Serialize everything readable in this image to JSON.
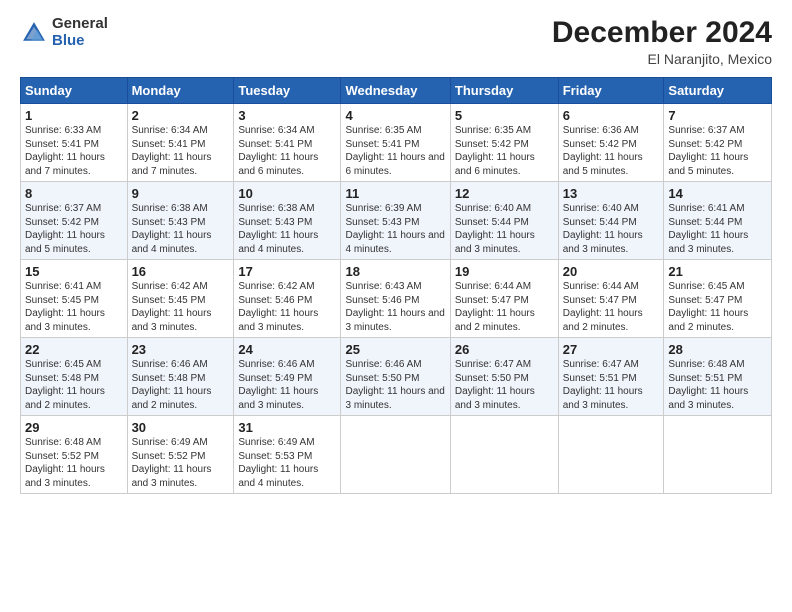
{
  "header": {
    "logo_general": "General",
    "logo_blue": "Blue",
    "month_year": "December 2024",
    "location": "El Naranjito, Mexico"
  },
  "days_of_week": [
    "Sunday",
    "Monday",
    "Tuesday",
    "Wednesday",
    "Thursday",
    "Friday",
    "Saturday"
  ],
  "weeks": [
    [
      {
        "day": "1",
        "sunrise": "6:33 AM",
        "sunset": "5:41 PM",
        "daylight": "11 hours and 7 minutes."
      },
      {
        "day": "2",
        "sunrise": "6:34 AM",
        "sunset": "5:41 PM",
        "daylight": "11 hours and 7 minutes."
      },
      {
        "day": "3",
        "sunrise": "6:34 AM",
        "sunset": "5:41 PM",
        "daylight": "11 hours and 6 minutes."
      },
      {
        "day": "4",
        "sunrise": "6:35 AM",
        "sunset": "5:41 PM",
        "daylight": "11 hours and 6 minutes."
      },
      {
        "day": "5",
        "sunrise": "6:35 AM",
        "sunset": "5:42 PM",
        "daylight": "11 hours and 6 minutes."
      },
      {
        "day": "6",
        "sunrise": "6:36 AM",
        "sunset": "5:42 PM",
        "daylight": "11 hours and 5 minutes."
      },
      {
        "day": "7",
        "sunrise": "6:37 AM",
        "sunset": "5:42 PM",
        "daylight": "11 hours and 5 minutes."
      }
    ],
    [
      {
        "day": "8",
        "sunrise": "6:37 AM",
        "sunset": "5:42 PM",
        "daylight": "11 hours and 5 minutes."
      },
      {
        "day": "9",
        "sunrise": "6:38 AM",
        "sunset": "5:43 PM",
        "daylight": "11 hours and 4 minutes."
      },
      {
        "day": "10",
        "sunrise": "6:38 AM",
        "sunset": "5:43 PM",
        "daylight": "11 hours and 4 minutes."
      },
      {
        "day": "11",
        "sunrise": "6:39 AM",
        "sunset": "5:43 PM",
        "daylight": "11 hours and 4 minutes."
      },
      {
        "day": "12",
        "sunrise": "6:40 AM",
        "sunset": "5:44 PM",
        "daylight": "11 hours and 3 minutes."
      },
      {
        "day": "13",
        "sunrise": "6:40 AM",
        "sunset": "5:44 PM",
        "daylight": "11 hours and 3 minutes."
      },
      {
        "day": "14",
        "sunrise": "6:41 AM",
        "sunset": "5:44 PM",
        "daylight": "11 hours and 3 minutes."
      }
    ],
    [
      {
        "day": "15",
        "sunrise": "6:41 AM",
        "sunset": "5:45 PM",
        "daylight": "11 hours and 3 minutes."
      },
      {
        "day": "16",
        "sunrise": "6:42 AM",
        "sunset": "5:45 PM",
        "daylight": "11 hours and 3 minutes."
      },
      {
        "day": "17",
        "sunrise": "6:42 AM",
        "sunset": "5:46 PM",
        "daylight": "11 hours and 3 minutes."
      },
      {
        "day": "18",
        "sunrise": "6:43 AM",
        "sunset": "5:46 PM",
        "daylight": "11 hours and 3 minutes."
      },
      {
        "day": "19",
        "sunrise": "6:44 AM",
        "sunset": "5:47 PM",
        "daylight": "11 hours and 2 minutes."
      },
      {
        "day": "20",
        "sunrise": "6:44 AM",
        "sunset": "5:47 PM",
        "daylight": "11 hours and 2 minutes."
      },
      {
        "day": "21",
        "sunrise": "6:45 AM",
        "sunset": "5:47 PM",
        "daylight": "11 hours and 2 minutes."
      }
    ],
    [
      {
        "day": "22",
        "sunrise": "6:45 AM",
        "sunset": "5:48 PM",
        "daylight": "11 hours and 2 minutes."
      },
      {
        "day": "23",
        "sunrise": "6:46 AM",
        "sunset": "5:48 PM",
        "daylight": "11 hours and 2 minutes."
      },
      {
        "day": "24",
        "sunrise": "6:46 AM",
        "sunset": "5:49 PM",
        "daylight": "11 hours and 3 minutes."
      },
      {
        "day": "25",
        "sunrise": "6:46 AM",
        "sunset": "5:50 PM",
        "daylight": "11 hours and 3 minutes."
      },
      {
        "day": "26",
        "sunrise": "6:47 AM",
        "sunset": "5:50 PM",
        "daylight": "11 hours and 3 minutes."
      },
      {
        "day": "27",
        "sunrise": "6:47 AM",
        "sunset": "5:51 PM",
        "daylight": "11 hours and 3 minutes."
      },
      {
        "day": "28",
        "sunrise": "6:48 AM",
        "sunset": "5:51 PM",
        "daylight": "11 hours and 3 minutes."
      }
    ],
    [
      {
        "day": "29",
        "sunrise": "6:48 AM",
        "sunset": "5:52 PM",
        "daylight": "11 hours and 3 minutes."
      },
      {
        "day": "30",
        "sunrise": "6:49 AM",
        "sunset": "5:52 PM",
        "daylight": "11 hours and 3 minutes."
      },
      {
        "day": "31",
        "sunrise": "6:49 AM",
        "sunset": "5:53 PM",
        "daylight": "11 hours and 4 minutes."
      },
      null,
      null,
      null,
      null
    ]
  ]
}
